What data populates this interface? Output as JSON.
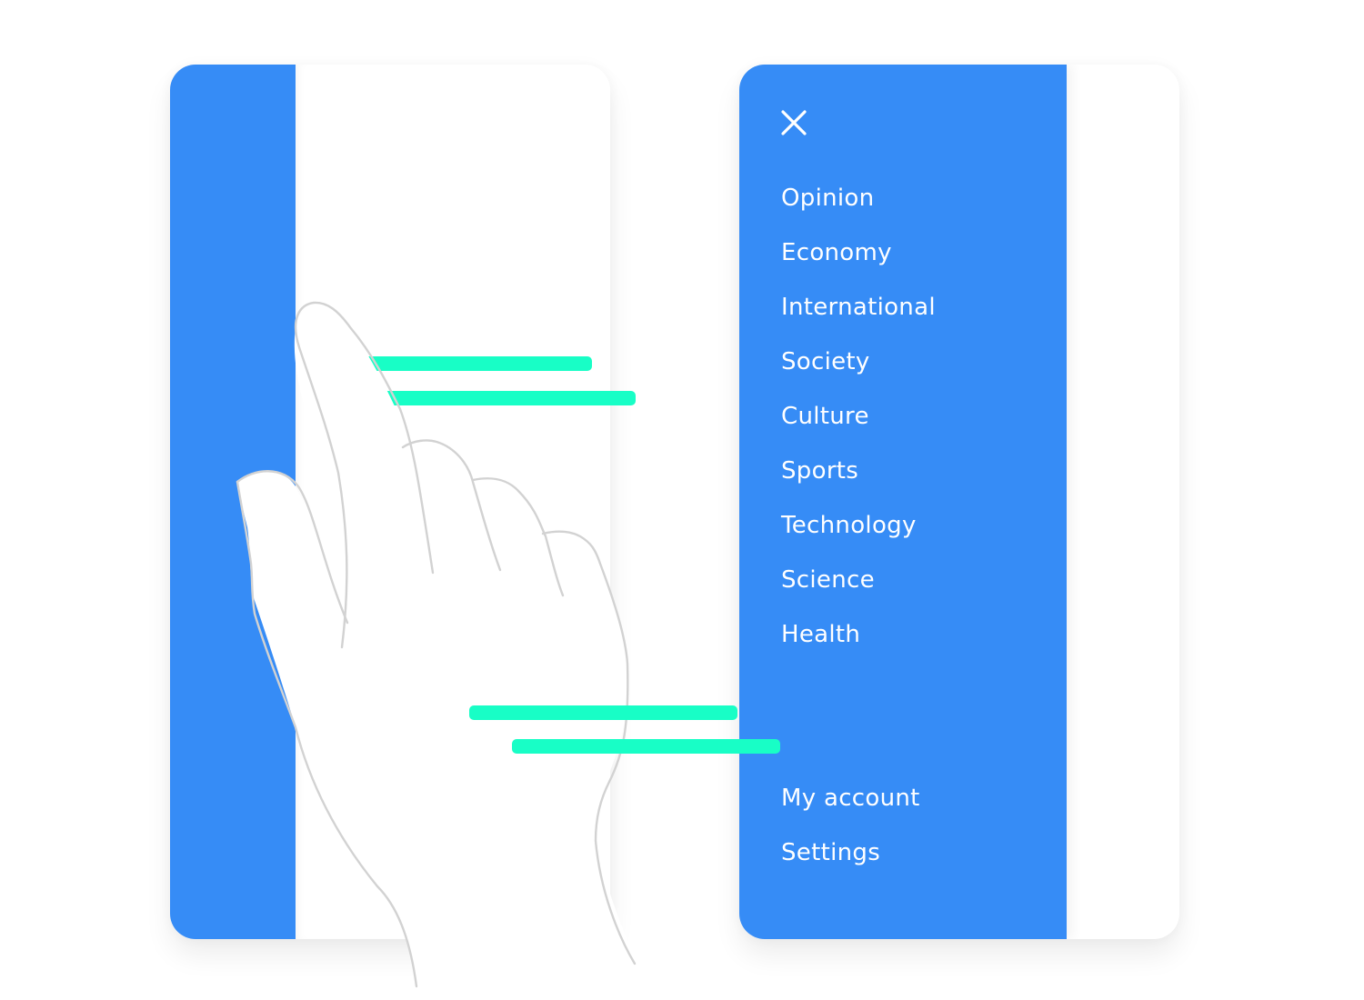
{
  "illustration": {
    "description": "Swipe gesture opening a navigation drawer",
    "colors": {
      "primary": "#368cf6",
      "swipe_accent": "#18fec6",
      "hand_outline": "#d2d2d2",
      "surface": "#ffffff"
    },
    "left_screen": {
      "state": "drawer-collapsed"
    },
    "gesture": {
      "type": "swipe-right",
      "icon": "hand-swipe-icon"
    },
    "right_screen": {
      "state": "drawer-open",
      "close_icon": "close-icon",
      "menu_items": [
        {
          "label": "Opinion"
        },
        {
          "label": "Economy"
        },
        {
          "label": "International"
        },
        {
          "label": "Society"
        },
        {
          "label": "Culture"
        },
        {
          "label": "Sports"
        },
        {
          "label": "Technology"
        },
        {
          "label": "Science"
        },
        {
          "label": "Health"
        }
      ],
      "bottom_items": [
        {
          "label": "My account"
        },
        {
          "label": "Settings"
        }
      ]
    }
  }
}
